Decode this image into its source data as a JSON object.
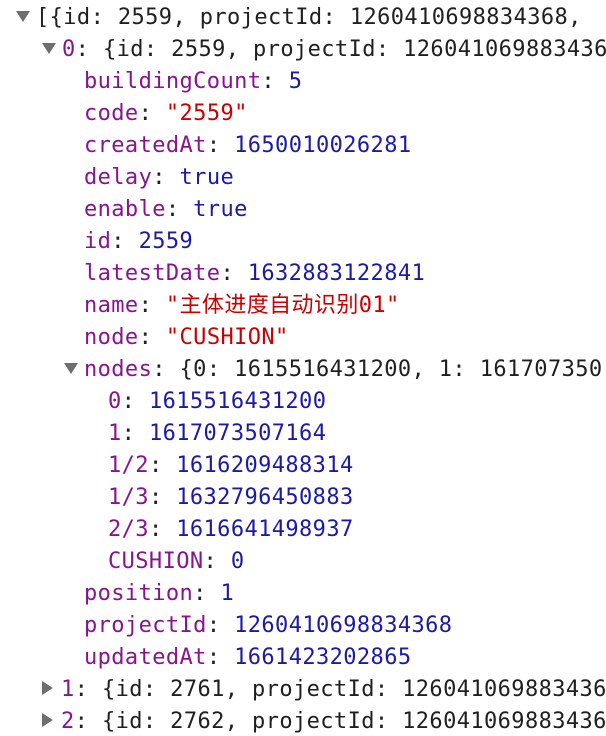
{
  "root_summary": "[{id: 2559, projectId: 1260410698834368,",
  "item0": {
    "index": "0",
    "summary": "{id: 2559, projectId: 126041069883436",
    "props": [
      {
        "key": "buildingCount",
        "value": "5",
        "type": "num"
      },
      {
        "key": "code",
        "value": "\"2559\"",
        "type": "str"
      },
      {
        "key": "createdAt",
        "value": "1650010026281",
        "type": "num"
      },
      {
        "key": "delay",
        "value": "true",
        "type": "kw"
      },
      {
        "key": "enable",
        "value": "true",
        "type": "kw"
      },
      {
        "key": "id",
        "value": "2559",
        "type": "num"
      },
      {
        "key": "latestDate",
        "value": "1632883122841",
        "type": "num"
      },
      {
        "key": "name",
        "value": "\"主体进度自动识别01\"",
        "type": "str"
      },
      {
        "key": "node",
        "value": "\"CUSHION\"",
        "type": "str"
      }
    ],
    "nodes": {
      "key": "nodes",
      "summary": "{0: 1615516431200, 1: 161707350",
      "entries": [
        {
          "key": "0",
          "value": "1615516431200"
        },
        {
          "key": "1",
          "value": "1617073507164"
        },
        {
          "key": "1/2",
          "value": "1616209488314"
        },
        {
          "key": "1/3",
          "value": "1632796450883"
        },
        {
          "key": "2/3",
          "value": "1616641498937"
        },
        {
          "key": "CUSHION",
          "value": "0"
        }
      ]
    },
    "props_after": [
      {
        "key": "position",
        "value": "1",
        "type": "num"
      },
      {
        "key": "projectId",
        "value": "1260410698834368",
        "type": "num"
      },
      {
        "key": "updatedAt",
        "value": "1661423202865",
        "type": "num"
      }
    ]
  },
  "collapsed_items": [
    {
      "index": "1",
      "summary": "{id: 2761, projectId: 126041069883436"
    },
    {
      "index": "2",
      "summary": "{id: 2762, projectId: 126041069883436"
    }
  ],
  "colors": {
    "key": "#881391",
    "number": "#1a1aa6",
    "string": "#c80000",
    "triangle": "#6e6e6e"
  }
}
